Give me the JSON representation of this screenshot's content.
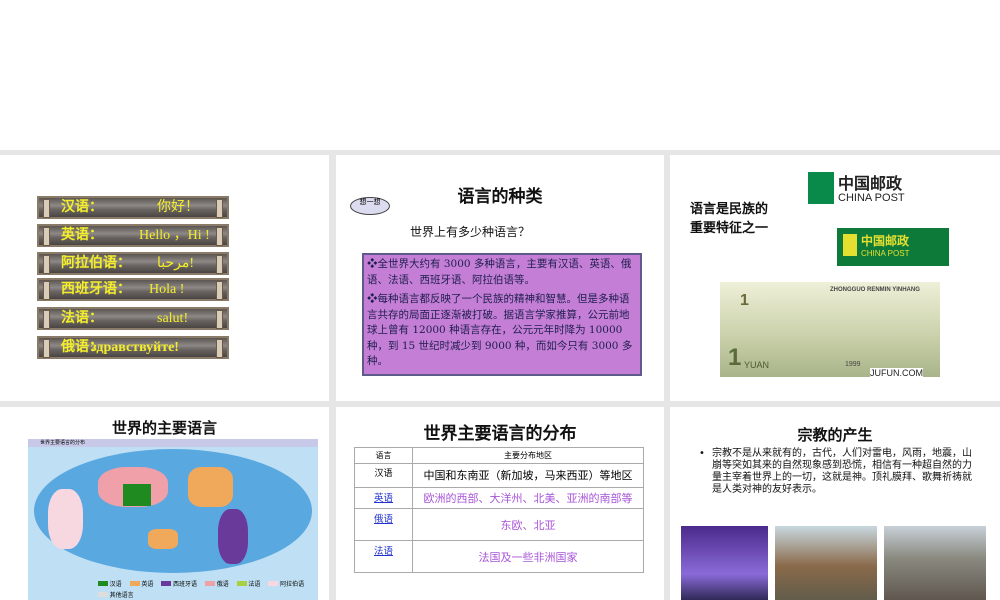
{
  "slide1": {
    "rows": [
      {
        "lang": "汉语：",
        "greeting": "你好！"
      },
      {
        "lang": "英语：",
        "greeting": "Hello ，Hi !"
      },
      {
        "lang": "阿拉伯语：",
        "greeting": "مرحبا!"
      },
      {
        "lang": "西班牙语：",
        "greeting": "Hola !"
      },
      {
        "lang": "法语：",
        "greeting": "salut!"
      },
      {
        "lang": "俄语：",
        "greeting": "здравствуйте!"
      }
    ]
  },
  "slide2": {
    "title": "语言的种类",
    "cloud": "想一想",
    "question": "世界上有多少种语言？",
    "p1": "❖全世界大约有 3000 多种语言，主要有汉语、英语、俄语、法语、西班牙语、阿拉伯语等。",
    "p2": "❖每种语言都反映了一个民族的精神和智慧。但是多种语言共存的局面正逐渐被打破。据语言学家推算，公元前地球上曾有 12000 种语言存在，公元元年时降为 10000 种，到 15 世纪时减少到 9000 种，而如今只有 3000 多种。"
  },
  "slide3": {
    "text1": "语言是民族的",
    "text2": "重要特征之一",
    "logo_cn": "中国邮政",
    "logo_en": "CHINA POST",
    "note_title": "ZHONGGUO RENMIN YINHANG",
    "note_value": "1",
    "note_unit": "YUAN",
    "note_year": "1999",
    "watermark": "JUFUN.COM"
  },
  "slide4": {
    "title": "世界的主要语言",
    "map_title": "世界主要语言的分布",
    "legend": [
      "汉语",
      "英语",
      "西班牙语",
      "俄语",
      "法语",
      "阿拉伯语",
      "其他语言"
    ],
    "colors": [
      "#1f8a1f",
      "#f0a85a",
      "#6a3a9a",
      "#f0a0a8",
      "#a8d040",
      "#f8d8e0",
      "#dddddd"
    ]
  },
  "slide5": {
    "title": "世界主要语言的分布",
    "headers": [
      "语言",
      "主要分布地区"
    ],
    "rows": [
      {
        "lang": "汉语",
        "region": "中国和东南亚（新加坡，马来西亚）等地区"
      },
      {
        "lang": "英语",
        "region": "欧洲的西部、大洋州、北美、亚洲的南部等"
      },
      {
        "lang": "俄语",
        "region": "东欧、北亚"
      },
      {
        "lang": "法语",
        "region": "法国及一些非洲国家"
      }
    ]
  },
  "slide6": {
    "title": "宗教的产生",
    "bullet": "宗教不是从来就有的，古代，人们对雷电，风雨，地震，山崩等突如其来的自然现象感到恐慌，相信有一种超自然的力量主宰着世界上的一切，这就是神。顶礼膜拜、歌舞祈祷就是人类对神的友好表示。"
  }
}
